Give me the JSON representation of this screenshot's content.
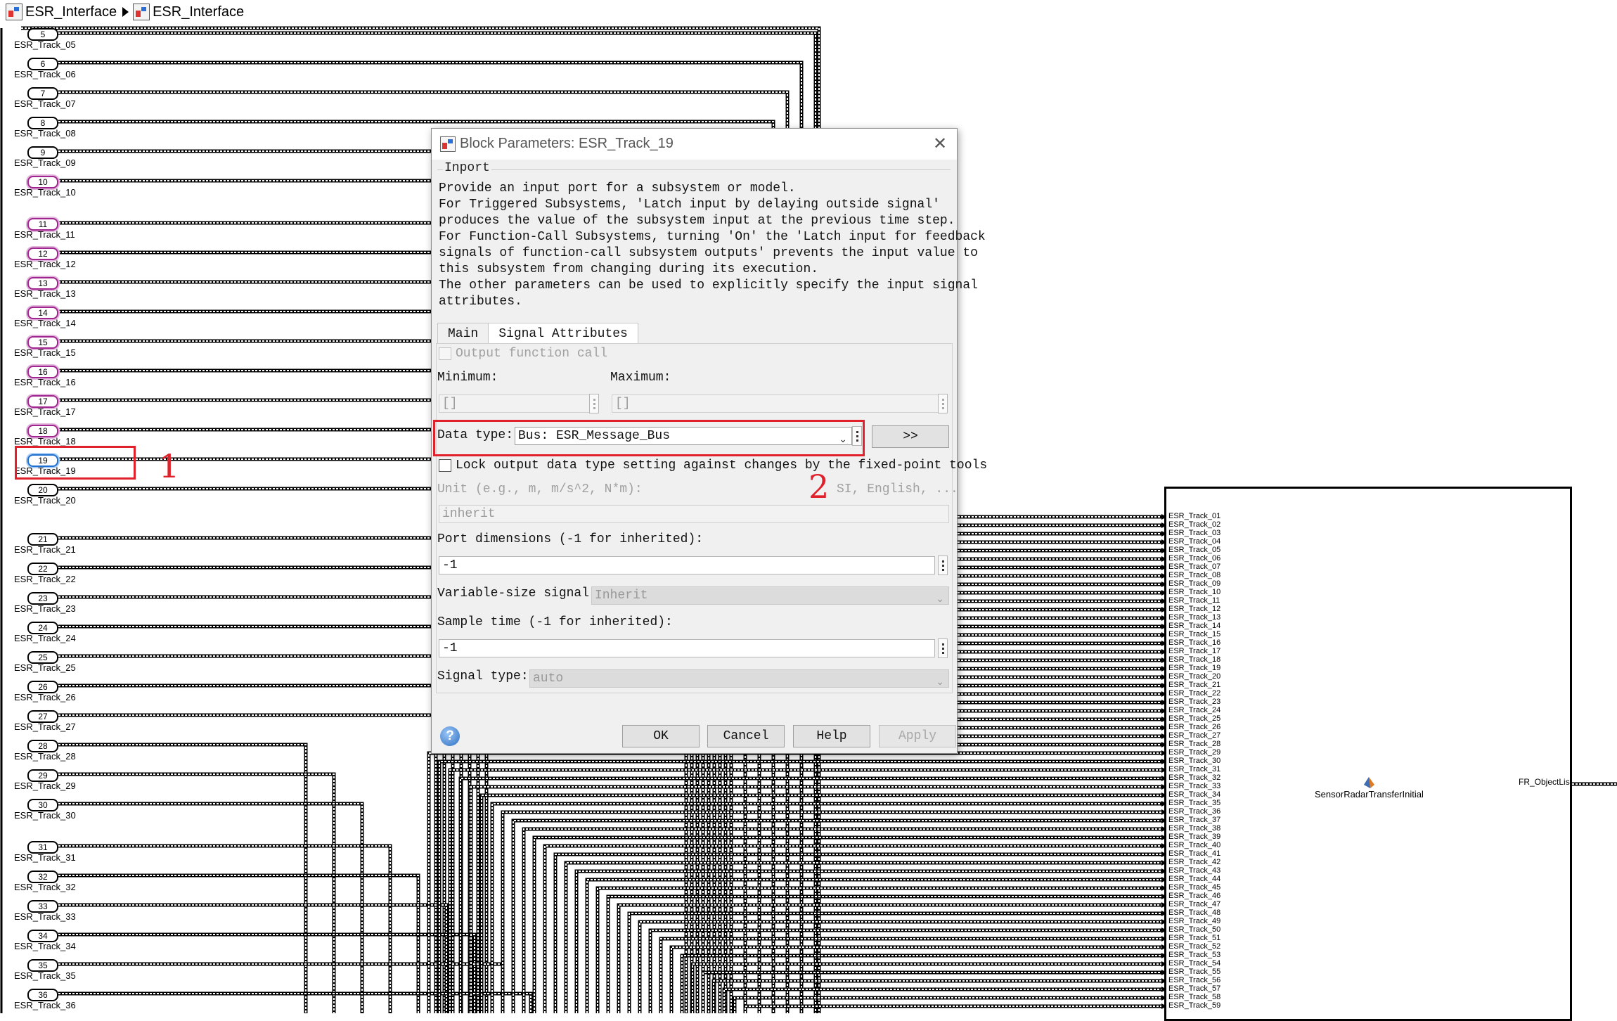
{
  "breadcrumb": {
    "root": "ESR_Interface",
    "current": "ESR_Interface"
  },
  "inports": [
    {
      "num": "5",
      "name": "ESR_Track_05"
    },
    {
      "num": "6",
      "name": "ESR_Track_06"
    },
    {
      "num": "7",
      "name": "ESR_Track_07"
    },
    {
      "num": "8",
      "name": "ESR_Track_08"
    },
    {
      "num": "9",
      "name": "ESR_Track_09"
    },
    {
      "num": "10",
      "name": "ESR_Track_10"
    },
    {
      "num": "11",
      "name": "ESR_Track_11"
    },
    {
      "num": "12",
      "name": "ESR_Track_12"
    },
    {
      "num": "13",
      "name": "ESR_Track_13"
    },
    {
      "num": "14",
      "name": "ESR_Track_14"
    },
    {
      "num": "15",
      "name": "ESR_Track_15"
    },
    {
      "num": "16",
      "name": "ESR_Track_16"
    },
    {
      "num": "17",
      "name": "ESR_Track_17"
    },
    {
      "num": "18",
      "name": "ESR_Track_18"
    },
    {
      "num": "19",
      "name": "ESR_Track_19"
    },
    {
      "num": "20",
      "name": "ESR_Track_20"
    },
    {
      "num": "21",
      "name": "ESR_Track_21"
    },
    {
      "num": "22",
      "name": "ESR_Track_22"
    },
    {
      "num": "23",
      "name": "ESR_Track_23"
    },
    {
      "num": "24",
      "name": "ESR_Track_24"
    },
    {
      "num": "25",
      "name": "ESR_Track_25"
    },
    {
      "num": "26",
      "name": "ESR_Track_26"
    },
    {
      "num": "27",
      "name": "ESR_Track_27"
    },
    {
      "num": "28",
      "name": "ESR_Track_28"
    },
    {
      "num": "29",
      "name": "ESR_Track_29"
    },
    {
      "num": "30",
      "name": "ESR_Track_30"
    },
    {
      "num": "31",
      "name": "ESR_Track_31"
    },
    {
      "num": "32",
      "name": "ESR_Track_32"
    },
    {
      "num": "33",
      "name": "ESR_Track_33"
    },
    {
      "num": "34",
      "name": "ESR_Track_34"
    },
    {
      "num": "35",
      "name": "ESR_Track_35"
    },
    {
      "num": "36",
      "name": "ESR_Track_36"
    }
  ],
  "subsystem": {
    "name": "SensorRadarTransferInitial",
    "input_ports": [
      "ESR_Track_01",
      "ESR_Track_02",
      "ESR_Track_03",
      "ESR_Track_04",
      "ESR_Track_05",
      "ESR_Track_06",
      "ESR_Track_07",
      "ESR_Track_08",
      "ESR_Track_09",
      "ESR_Track_10",
      "ESR_Track_11",
      "ESR_Track_12",
      "ESR_Track_13",
      "ESR_Track_14",
      "ESR_Track_15",
      "ESR_Track_16",
      "ESR_Track_17",
      "ESR_Track_18",
      "ESR_Track_19",
      "ESR_Track_20",
      "ESR_Track_21",
      "ESR_Track_22",
      "ESR_Track_23",
      "ESR_Track_24",
      "ESR_Track_25",
      "ESR_Track_26",
      "ESR_Track_27",
      "ESR_Track_28",
      "ESR_Track_29",
      "ESR_Track_30",
      "ESR_Track_31",
      "ESR_Track_32",
      "ESR_Track_33",
      "ESR_Track_34",
      "ESR_Track_35",
      "ESR_Track_36",
      "ESR_Track_37",
      "ESR_Track_38",
      "ESR_Track_39",
      "ESR_Track_40",
      "ESR_Track_41",
      "ESR_Track_42",
      "ESR_Track_43",
      "ESR_Track_44",
      "ESR_Track_45",
      "ESR_Track_46",
      "ESR_Track_47",
      "ESR_Track_48",
      "ESR_Track_49",
      "ESR_Track_50",
      "ESR_Track_51",
      "ESR_Track_52",
      "ESR_Track_53",
      "ESR_Track_54",
      "ESR_Track_55",
      "ESR_Track_56",
      "ESR_Track_57",
      "ESR_Track_58",
      "ESR_Track_59"
    ],
    "output_port": "FR_ObjectList",
    "icon": "matlab-function-icon"
  },
  "annotations": {
    "first": "1",
    "second": "2",
    "color": "#e0202a"
  },
  "dialog": {
    "title": "Block Parameters: ESR_Track_19",
    "group": "Inport",
    "description": "Provide an input port for a subsystem or model.\nFor Triggered Subsystems, 'Latch input by delaying outside signal'\nproduces the value of the subsystem input at the previous time step.\nFor Function-Call Subsystems, turning 'On' the 'Latch input for feedback\nsignals of function-call subsystem outputs' prevents the input value to\nthis subsystem from changing during its execution.\nThe other parameters can be used to explicitly specify the input signal\nattributes.",
    "tabs": [
      "Main",
      "Signal Attributes"
    ],
    "output_function_call": "Output function call",
    "minimum_label": "Minimum:",
    "minimum_value": "[]",
    "maximum_label": "Maximum:",
    "maximum_value": "[]",
    "data_type_label": "Data type:",
    "data_type_value": "Bus: ESR_Message_Bus",
    "assistant_button": ">>",
    "lock_label": "Lock output data type setting against changes by the fixed-point tools",
    "unit_label": "Unit (e.g., m, m/s^2, N*m):",
    "unit_hint": "SI, English, ...",
    "unit_value": "inherit",
    "port_dim_label": "Port dimensions (-1 for inherited):",
    "port_dim_value": "-1",
    "var_size_label": "Variable-size signal:",
    "var_size_value": "Inherit",
    "sample_time_label": "Sample time (-1 for inherited):",
    "sample_time_value": "-1",
    "signal_type_label": "Signal type:",
    "signal_type_value": "auto",
    "ok": "OK",
    "cancel": "Cancel",
    "help": "Help",
    "apply": "Apply",
    "help_glyph": "?"
  }
}
